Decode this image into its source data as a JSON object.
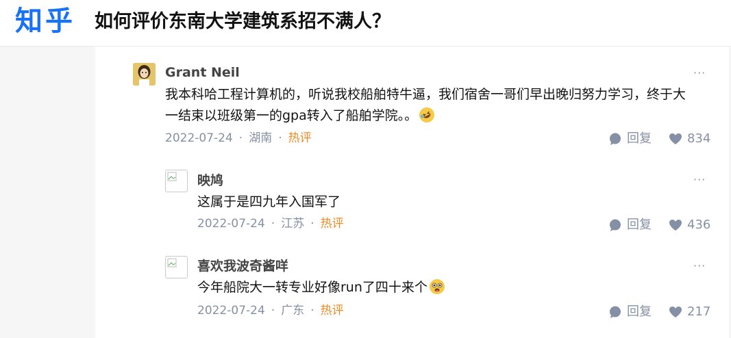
{
  "header": {
    "logo": "知乎",
    "question_title": "如何评价东南大学建筑系招不满人？"
  },
  "comments": [
    {
      "author": "Grant Neil",
      "content": "我本科哈工程计算机的，听说我校船舶特牛逼，我们宿舍一哥们早出晚归努力学习，终于大一结束以班级第一的gpa转入了船舶学院。。",
      "date": "2022-07-24",
      "location": "湖南",
      "hot": "热评",
      "reply_label": "回复",
      "likes": "834",
      "emoji": "rolling-on-floor-laughing-icon"
    },
    {
      "author": "映鸠",
      "content": "这属于是四九年入国军了",
      "date": "2022-07-24",
      "location": "江苏",
      "hot": "热评",
      "reply_label": "回复",
      "likes": "436"
    },
    {
      "author": "喜欢我波奇酱咩",
      "content": "今年船院大一转专业好像run了四十来个",
      "date": "2022-07-24",
      "location": "广东",
      "hot": "热评",
      "reply_label": "回复",
      "likes": "217",
      "emoji": "drooling-face-icon"
    }
  ],
  "more_label": "···",
  "separator": "·",
  "colors": {
    "brand": "#1772f6",
    "hot": "#f08a24",
    "meta": "#8590a6"
  }
}
